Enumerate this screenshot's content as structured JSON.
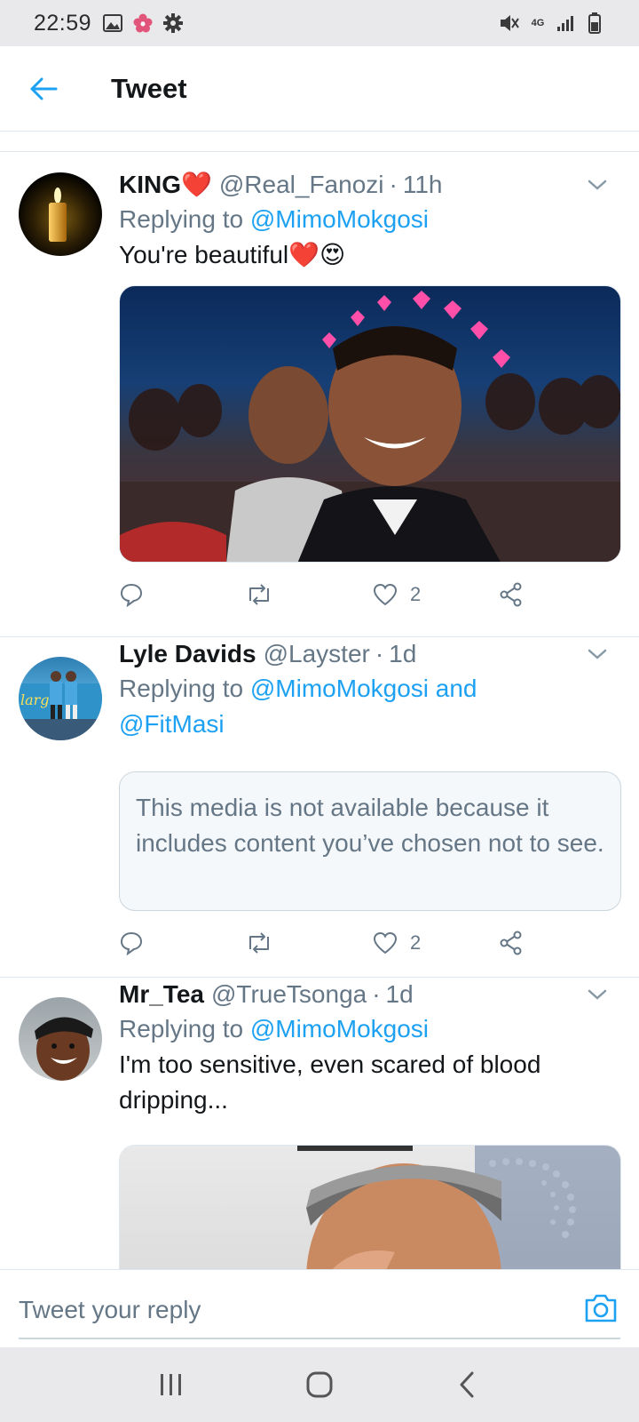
{
  "status_bar": {
    "time": "22:59",
    "network": "4G",
    "icons": [
      "image-icon",
      "flower-icon",
      "gear-icon",
      "mute-icon",
      "network-4g-icon",
      "signal-icon",
      "battery-icon"
    ]
  },
  "header": {
    "title": "Tweet",
    "back_icon": "arrow-left-icon",
    "accent_color": "#1da1f2"
  },
  "tweets": [
    {
      "name": "KING",
      "name_emoji": "❤️",
      "handle": "@Real_Fanozi",
      "separator": "·",
      "time": "11h",
      "replying_prefix": "Replying to",
      "replying_to": "@MimoMokgosi",
      "text": "You're beautiful❤️😍",
      "media": "photo",
      "actions": {
        "reply_count": "",
        "retweet_count": "",
        "like_count": "2"
      }
    },
    {
      "name": "Lyle Davids",
      "handle": "@Layster",
      "separator": "·",
      "time": "1d",
      "replying_prefix": "Replying to",
      "replying_to": "@MimoMokgosi and",
      "replying_to_2": "@FitMasi",
      "withheld_notice": "This media is not available because it includes content you’ve chosen not to see.",
      "actions": {
        "reply_count": "",
        "retweet_count": "",
        "like_count": "2"
      }
    },
    {
      "name": "Mr_Tea",
      "handle": "@TrueTsonga",
      "separator": "·",
      "time": "1d",
      "replying_prefix": "Replying to",
      "replying_to": "@MimoMokgosi",
      "text_line1": "I'm too sensitive, even scared of blood",
      "text_line2": "dripping...",
      "media": "photo"
    }
  ],
  "composer": {
    "placeholder": "Tweet your reply",
    "camera_icon": "camera-icon"
  },
  "nav_bar": {
    "icons": [
      "recent-apps-icon",
      "home-icon",
      "back-icon"
    ]
  }
}
